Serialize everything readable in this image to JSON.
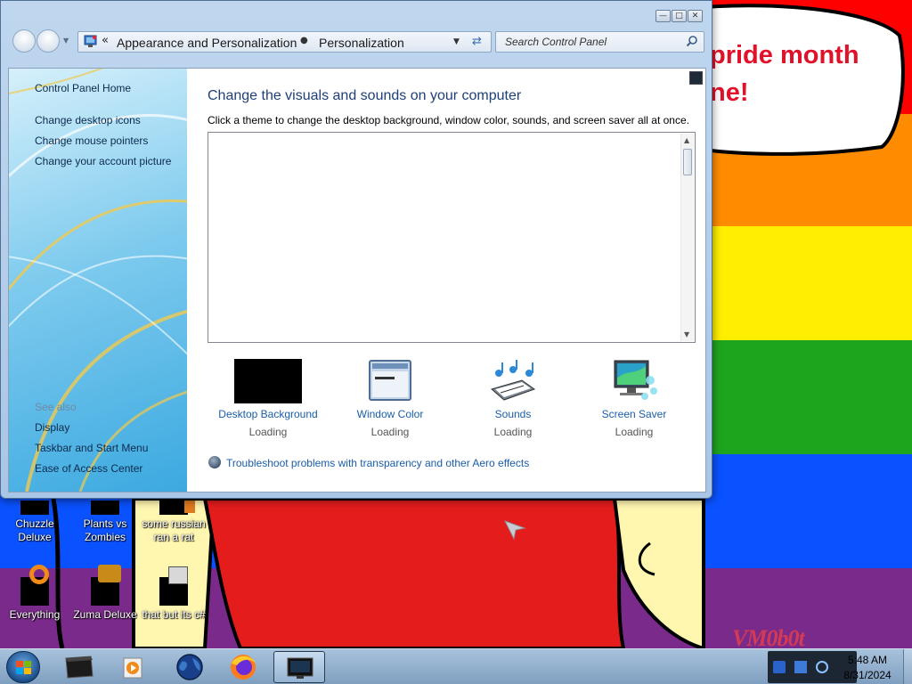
{
  "window": {
    "breadcrumb": [
      "Appearance and Personalization",
      "Personalization"
    ],
    "search_placeholder": "Search Control Panel"
  },
  "sidebar": {
    "home_link": "Control Panel Home",
    "links": [
      "Change desktop icons",
      "Change mouse pointers",
      "Change your account picture"
    ],
    "see_also_heading": "See also",
    "see_also_links": [
      "Display",
      "Taskbar and Start Menu",
      "Ease of Access Center"
    ]
  },
  "main": {
    "title": "Change the visuals and sounds on your computer",
    "description": "Click a theme to change the desktop background, window color, sounds, and screen saver all at once.",
    "settings": [
      {
        "label": "Desktop Background",
        "status": "Loading",
        "icon": "desktop-background-icon"
      },
      {
        "label": "Window Color",
        "status": "Loading",
        "icon": "window-color-icon"
      },
      {
        "label": "Sounds",
        "status": "Loading",
        "icon": "sounds-icon"
      },
      {
        "label": "Screen Saver",
        "status": "Loading",
        "icon": "screen-saver-icon"
      }
    ],
    "troubleshoot_link": "Troubleshoot problems with transparency and other Aero effects"
  },
  "desktop": {
    "wallpaper_text": [
      "pride month",
      "ne!"
    ],
    "signature": "VM0b0t",
    "icons": [
      {
        "label": "Chuzzle Deluxe"
      },
      {
        "label": "Plants vs Zombies"
      },
      {
        "label": "some russian ran a rat"
      },
      {
        "label": "Everything"
      },
      {
        "label": "Zuma Deluxe"
      },
      {
        "label": "that but its c#"
      }
    ],
    "stripe_colors": [
      "#ff0000",
      "#ff8c00",
      "#ffee00",
      "#1ea51e",
      "#0a52ff",
      "#7a2a8a"
    ]
  },
  "taskbar": {
    "pinned": [
      "terminal-icon",
      "media-player-icon",
      "globe-icon",
      "firefox-icon",
      "control-panel-icon"
    ],
    "time": "5:48 AM",
    "date": "8/31/2024"
  }
}
